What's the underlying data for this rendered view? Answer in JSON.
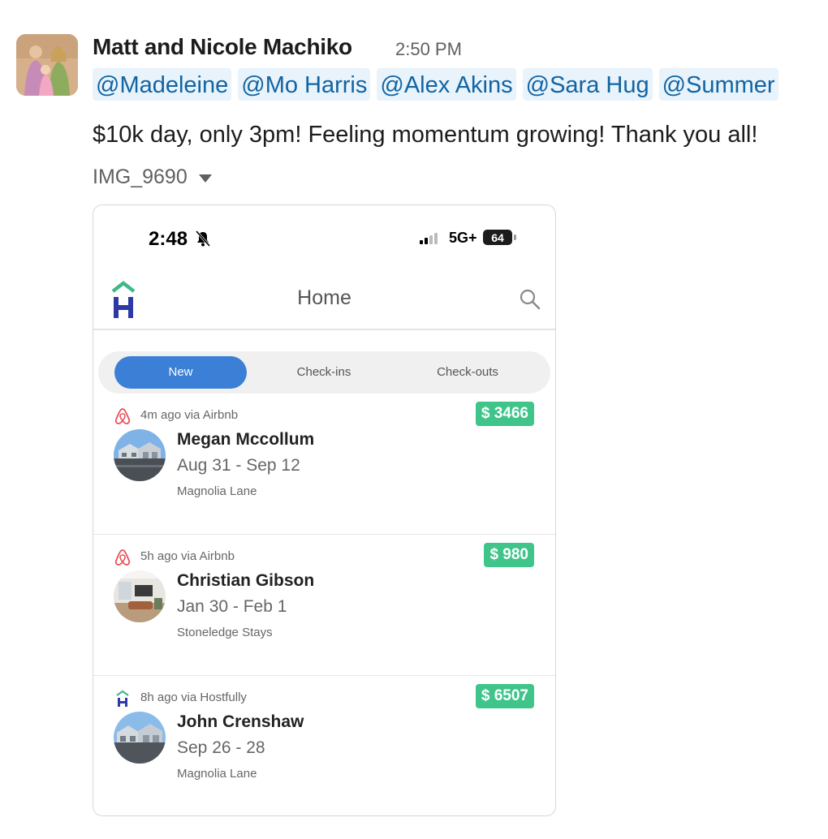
{
  "message": {
    "sender": "Matt and Nicole Machiko",
    "time": "2:50 PM",
    "mentions": [
      "@Madeleine",
      "@Mo Harris",
      "@Alex Akins",
      "@Sara Hug",
      "@Summer"
    ],
    "text": "$10k day, only 3pm! Feeling momentum growing! Thank you all!",
    "attachment_name": "IMG_9690"
  },
  "phone": {
    "status": {
      "time": "2:48",
      "network": "5G+",
      "battery": "64"
    },
    "nav": {
      "title": "Home"
    },
    "tabs": [
      {
        "label": "New",
        "active": true
      },
      {
        "label": "Check-ins",
        "active": false
      },
      {
        "label": "Check-outs",
        "active": false
      }
    ],
    "bookings": [
      {
        "source": "4m ago via Airbnb",
        "source_icon": "airbnb-icon",
        "amount": "$ 3466",
        "guest": "Megan Mccollum",
        "dates": "Aug 31 - Sep 12",
        "property": "Magnolia Lane"
      },
      {
        "source": "5h ago via Airbnb",
        "source_icon": "airbnb-icon",
        "amount": "$ 980",
        "guest": "Christian Gibson",
        "dates": "Jan 30 - Feb 1",
        "property": "Stoneledge Stays"
      },
      {
        "source": "8h ago via Hostfully",
        "source_icon": "hostfully-icon",
        "amount": "$ 6507",
        "guest": "John Crenshaw",
        "dates": "Sep 26 - 28",
        "property": "Magnolia Lane"
      }
    ]
  },
  "colors": {
    "mention_bg": "#e8f3fb",
    "mention_text": "#1264a3",
    "tab_active": "#3b7fd6",
    "amount_badge": "#3fc48a",
    "logo_green": "#3fb98a",
    "logo_blue": "#2d3aa6",
    "airbnb": "#e8505b"
  }
}
